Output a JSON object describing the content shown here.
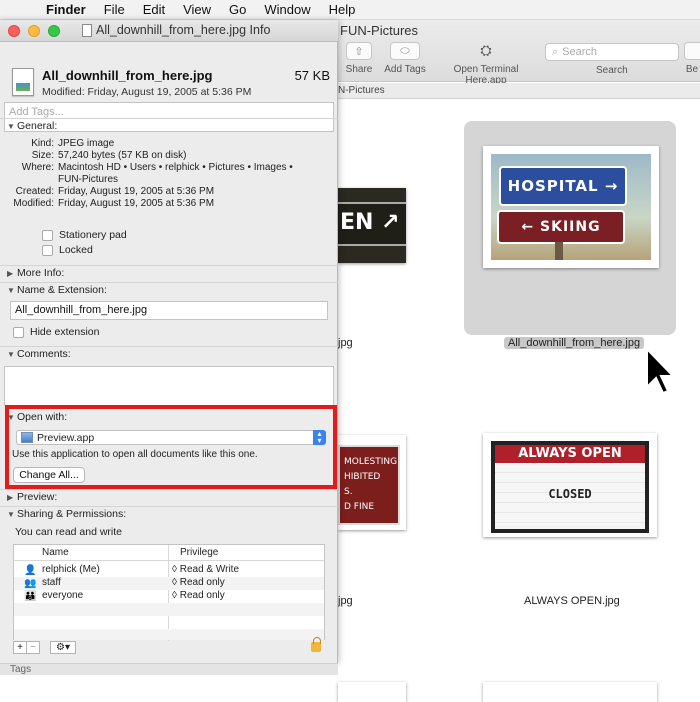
{
  "menubar": {
    "app": "Finder",
    "items": [
      "File",
      "Edit",
      "View",
      "Go",
      "Window",
      "Help"
    ]
  },
  "finder_window": {
    "title": "FUN-Pictures",
    "toolbar": {
      "share_label": "Share",
      "add_tags_label": "Add Tags",
      "open_terminal_label": "Open Terminal Here.app",
      "search_placeholder": "Search",
      "search_label": "Search",
      "cutoff_label": "Be"
    },
    "path": "N-Pictures",
    "items": [
      {
        "caption": "All_downhill_from_here.jpg",
        "selected": true
      },
      {
        "caption": "ALWAYS OPEN.jpg",
        "selected": false
      },
      {
        "caption": "jpg",
        "selected": false
      },
      {
        "caption": "jpg",
        "selected": false
      }
    ],
    "signs": {
      "hospital": "HOSPITAL →",
      "skiing": "← SKIING",
      "always_open": "ALWAYS OPEN",
      "closed": "CLOSED",
      "partial_dark": "EN ↗",
      "molest_lines": [
        "MOLESTING",
        "HIBITED",
        "S.",
        "D FINE"
      ]
    }
  },
  "info_window": {
    "title": "All_downhill_from_here.jpg Info",
    "file_name": "All_downhill_from_here.jpg",
    "file_size": "57 KB",
    "modified_line": "Modified: Friday, August 19, 2005 at 5:36 PM",
    "tags_placeholder": "Add Tags...",
    "general": {
      "header": "General:",
      "rows": [
        {
          "k": "Kind:",
          "v": "JPEG image"
        },
        {
          "k": "Size:",
          "v": "57,240 bytes (57 KB on disk)"
        },
        {
          "k": "Where:",
          "v": "Macintosh HD • Users • relphick • Pictures • Images •"
        },
        {
          "k": "",
          "v": "FUN-Pictures"
        },
        {
          "k": "Created:",
          "v": "Friday, August 19, 2005 at 5:36 PM"
        },
        {
          "k": "Modified:",
          "v": "Friday, August 19, 2005 at 5:36 PM"
        }
      ],
      "stationery_label": "Stationery pad",
      "locked_label": "Locked"
    },
    "more_info_header": "More Info:",
    "name_ext": {
      "header": "Name & Extension:",
      "value": "All_downhill_from_here.jpg",
      "hide_ext_label": "Hide extension"
    },
    "comments_header": "Comments:",
    "open_with": {
      "header": "Open with:",
      "app": "Preview.app",
      "note": "Use this application to open all documents like this one.",
      "change_all_label": "Change All..."
    },
    "preview_header": "Preview:",
    "sharing": {
      "header": "Sharing & Permissions:",
      "note": "You can read and write",
      "col_name": "Name",
      "col_priv": "Privilege",
      "rows": [
        {
          "icon": "single-user-icon",
          "name": "relphick (Me)",
          "priv": "◊ Read & Write"
        },
        {
          "icon": "group-icon",
          "name": "staff",
          "priv": "◊ Read only"
        },
        {
          "icon": "everyone-icon",
          "name": "everyone",
          "priv": "◊ Read only"
        }
      ]
    },
    "bottom_label": "Tags"
  },
  "colors": {
    "highlight_box": "#e21b1b",
    "stepper_blue": "#3b82f0"
  }
}
